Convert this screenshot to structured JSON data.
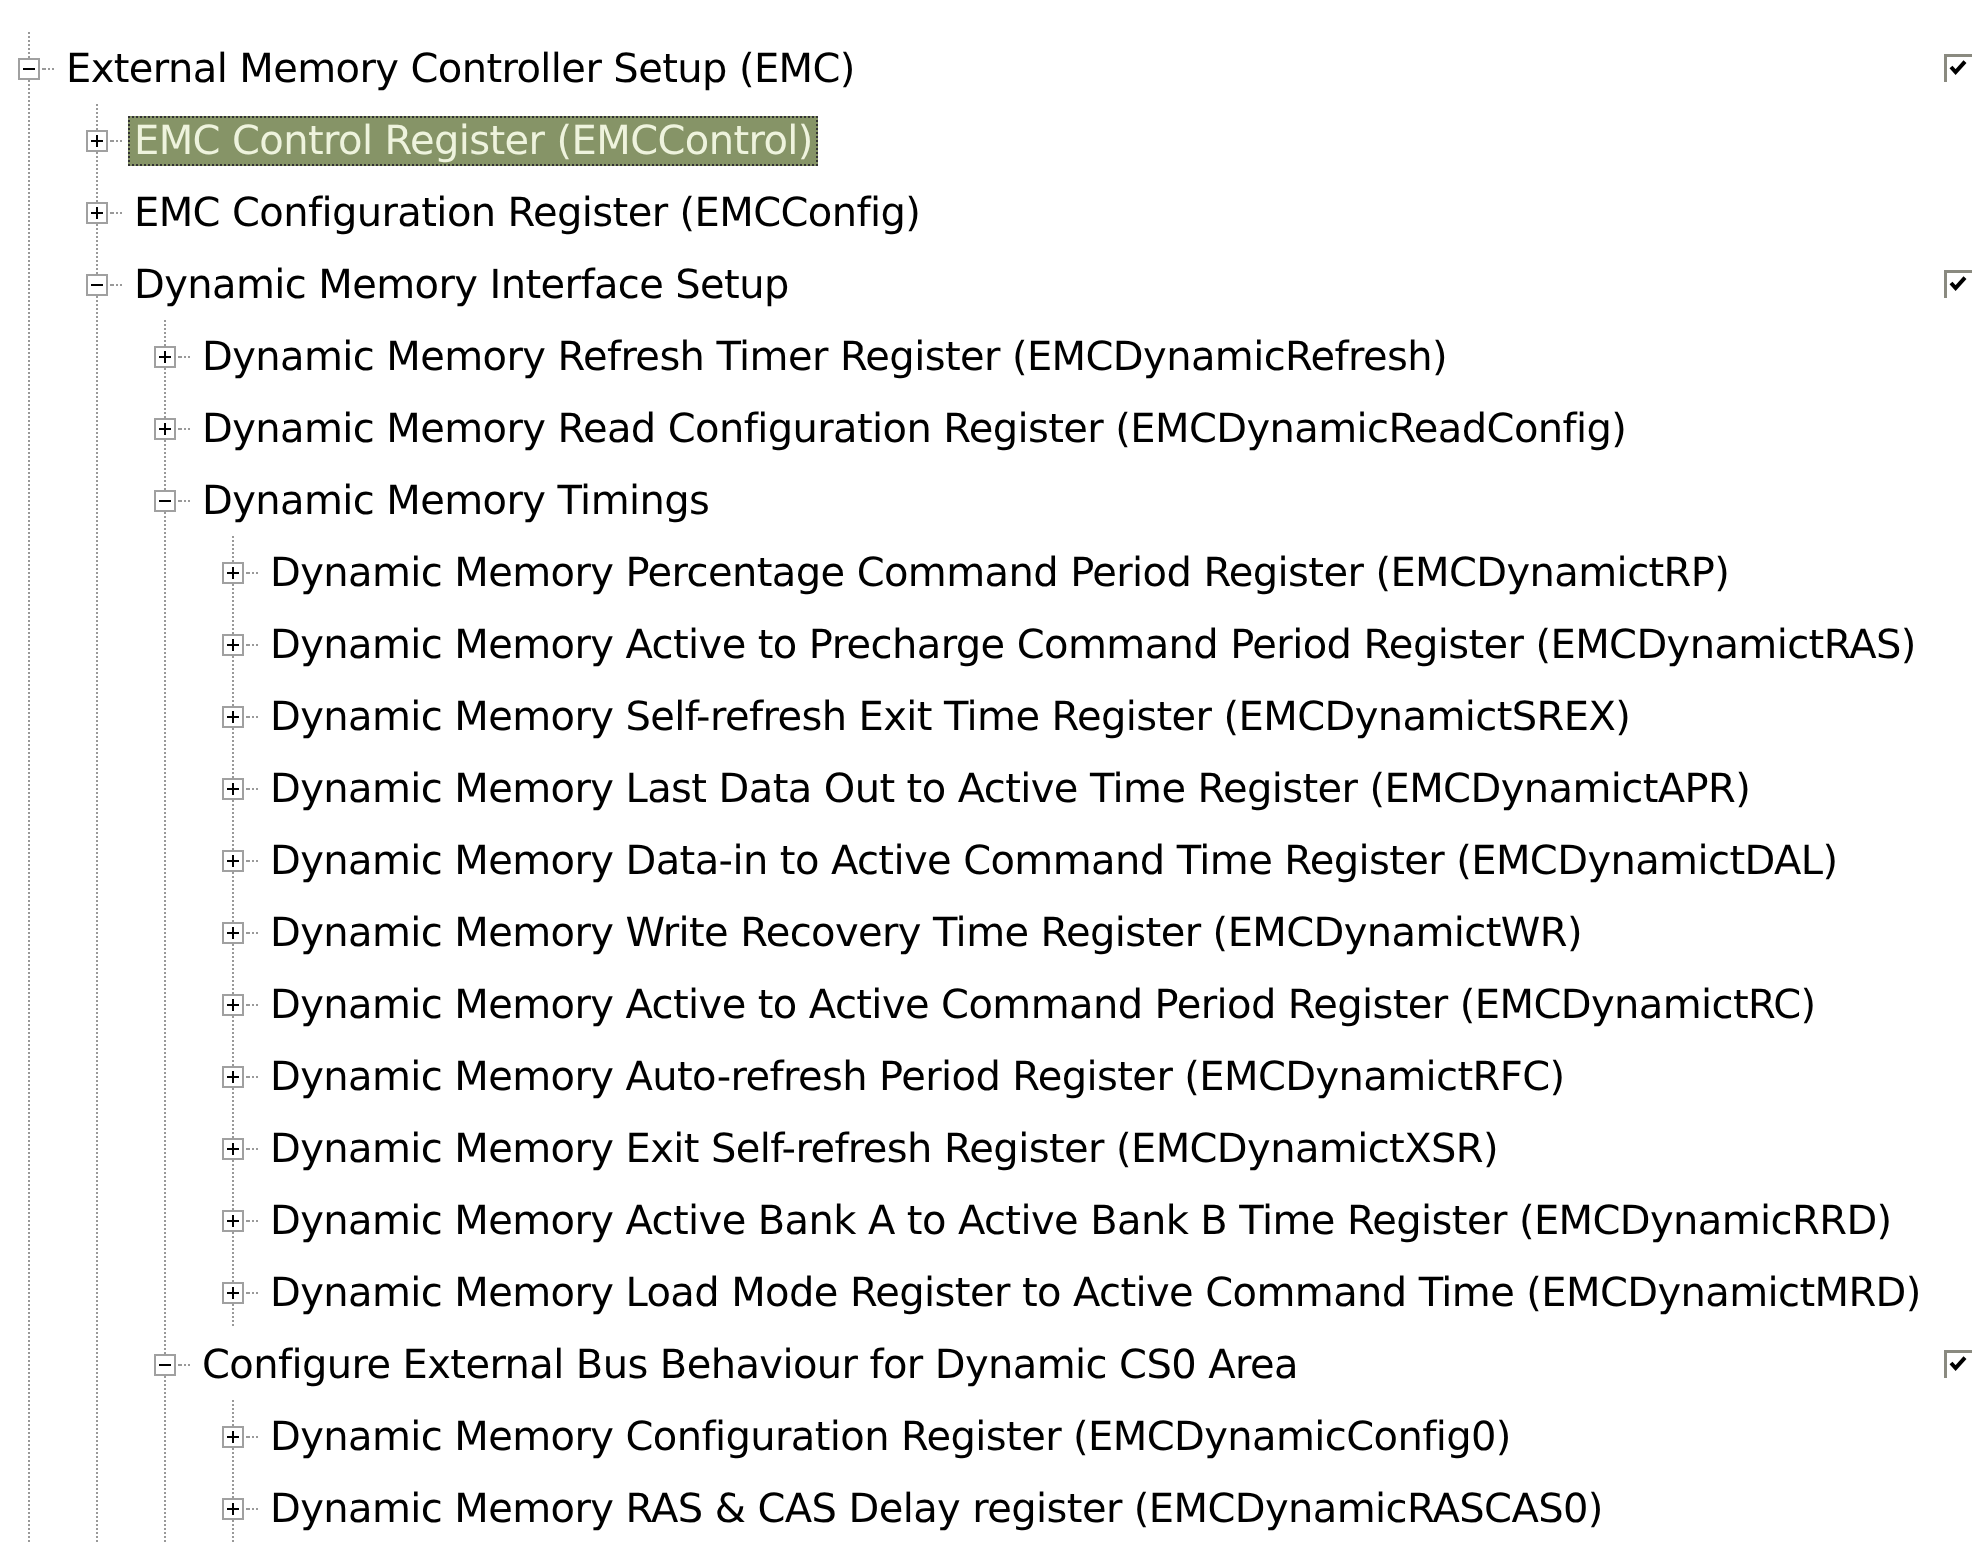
{
  "tree": [
    {
      "label": "External Memory Controller Setup (EMC)",
      "expanded": true,
      "selected": false,
      "checked": true,
      "children": [
        {
          "label": "EMC Control Register (EMCControl)",
          "expanded": false,
          "selected": true
        },
        {
          "label": "EMC Configuration Register (EMCConfig)",
          "expanded": false,
          "selected": false
        },
        {
          "label": "Dynamic Memory Interface Setup",
          "expanded": true,
          "selected": false,
          "checked": true,
          "children": [
            {
              "label": "Dynamic Memory Refresh Timer Register (EMCDynamicRefresh)",
              "expanded": false,
              "selected": false
            },
            {
              "label": "Dynamic Memory Read Configuration Register (EMCDynamicReadConfig)",
              "expanded": false,
              "selected": false
            },
            {
              "label": "Dynamic Memory Timings",
              "expanded": true,
              "selected": false,
              "children": [
                {
                  "label": "Dynamic Memory Percentage Command Period Register (EMCDynamictRP)",
                  "expanded": false,
                  "selected": false
                },
                {
                  "label": "Dynamic Memory Active to Precharge Command Period Register (EMCDynamictRAS)",
                  "expanded": false,
                  "selected": false
                },
                {
                  "label": "Dynamic Memory Self-refresh Exit Time Register (EMCDynamictSREX)",
                  "expanded": false,
                  "selected": false
                },
                {
                  "label": "Dynamic Memory Last Data Out to Active Time Register (EMCDynamictAPR)",
                  "expanded": false,
                  "selected": false
                },
                {
                  "label": "Dynamic Memory Data-in to Active Command Time Register (EMCDynamictDAL)",
                  "expanded": false,
                  "selected": false
                },
                {
                  "label": "Dynamic Memory Write Recovery Time Register (EMCDynamictWR)",
                  "expanded": false,
                  "selected": false
                },
                {
                  "label": "Dynamic Memory Active to Active Command Period Register (EMCDynamictRC)",
                  "expanded": false,
                  "selected": false
                },
                {
                  "label": "Dynamic Memory Auto-refresh Period Register (EMCDynamictRFC)",
                  "expanded": false,
                  "selected": false
                },
                {
                  "label": "Dynamic Memory Exit Self-refresh Register (EMCDynamictXSR)",
                  "expanded": false,
                  "selected": false
                },
                {
                  "label": "Dynamic Memory Active Bank A to Active Bank B Time Register (EMCDynamicRRD)",
                  "expanded": false,
                  "selected": false
                },
                {
                  "label": "Dynamic Memory Load Mode Register to Active Command Time (EMCDynamictMRD)",
                  "expanded": false,
                  "selected": false
                }
              ]
            },
            {
              "label": "Configure External Bus Behaviour for Dynamic CS0 Area",
              "expanded": true,
              "selected": false,
              "checked": true,
              "children": [
                {
                  "label": "Dynamic Memory Configuration Register (EMCDynamicConfig0)",
                  "expanded": false,
                  "selected": false
                },
                {
                  "label": "Dynamic Memory RAS & CAS Delay register (EMCDynamicRASCAS0)",
                  "expanded": false,
                  "selected": false
                }
              ]
            }
          ]
        }
      ]
    }
  ]
}
